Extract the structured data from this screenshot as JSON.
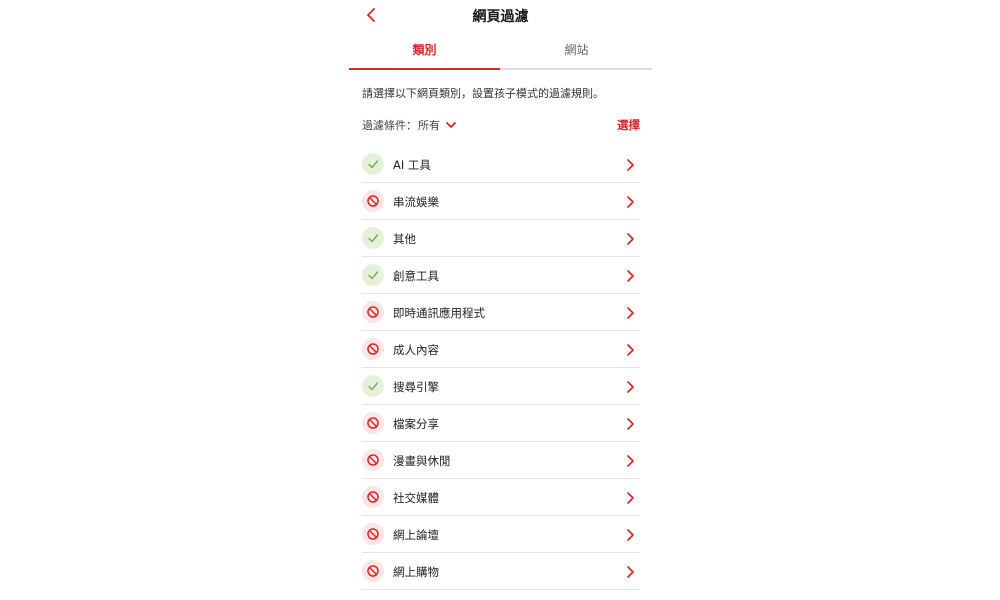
{
  "header": {
    "title": "網頁過濾",
    "back_icon": "chevron-left-icon"
  },
  "tabs": [
    {
      "label": "類別",
      "active": true
    },
    {
      "label": "網站",
      "active": false
    }
  ],
  "description": "請選擇以下網頁類別，設置孩子模式的過濾規則。",
  "filter": {
    "label": "過濾條件：",
    "value": "所有",
    "select_label": "選擇"
  },
  "colors": {
    "accent": "#d9262c",
    "allowed_bg": "#e6f1d9",
    "allowed_icon": "#7aa55a",
    "blocked_bg": "#fbe6e7",
    "blocked_icon": "#d9262c"
  },
  "categories": [
    {
      "label": "AI 工具",
      "status": "allowed"
    },
    {
      "label": "串流娛樂",
      "status": "blocked"
    },
    {
      "label": "其他",
      "status": "allowed"
    },
    {
      "label": "創意工具",
      "status": "allowed"
    },
    {
      "label": "即時通訊應用程式",
      "status": "blocked"
    },
    {
      "label": "成人內容",
      "status": "blocked"
    },
    {
      "label": "搜尋引擎",
      "status": "allowed"
    },
    {
      "label": "檔案分享",
      "status": "blocked"
    },
    {
      "label": "漫畫與休閒",
      "status": "blocked"
    },
    {
      "label": "社交媒體",
      "status": "blocked"
    },
    {
      "label": "網上論壇",
      "status": "blocked"
    },
    {
      "label": "網上購物",
      "status": "blocked"
    }
  ]
}
